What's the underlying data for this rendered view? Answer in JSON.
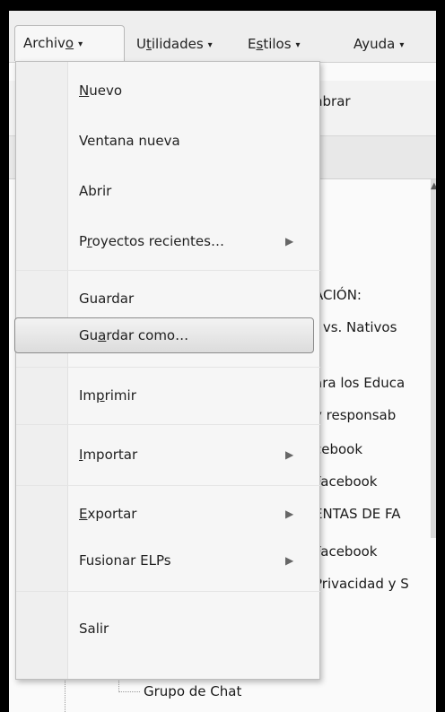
{
  "menubar": {
    "items": [
      {
        "label_pre": "Archiv",
        "label_u": "o",
        "label_post": "",
        "caret": "▾"
      },
      {
        "label_pre": "U",
        "label_u": "t",
        "label_post": "ilidades",
        "caret": "▾"
      },
      {
        "label_pre": "E",
        "label_u": "s",
        "label_post": "tilos",
        "caret": "▾"
      },
      {
        "label_pre": "Ayuda",
        "label_u": "",
        "label_post": "",
        "caret": "▾"
      }
    ]
  },
  "background": {
    "toolbar_fragment": "nbrar",
    "lines": [
      "ACIÓN:",
      "; vs. Nativos",
      "ara los Educa",
      "y responsab",
      "cebook",
      "Facebook",
      "ENTAS DE FA",
      "Facebook",
      "Privacidad y S",
      "Grupo de Chat"
    ]
  },
  "dropdown": {
    "items": [
      {
        "pre": "",
        "u": "N",
        "post": "uevo"
      },
      {
        "pre": "Ventana nueva",
        "u": "",
        "post": ""
      },
      {
        "pre": "Abrir",
        "u": "",
        "post": ""
      },
      {
        "pre": "P",
        "u": "r",
        "post": "oyectos recientes…",
        "arrow": "▶"
      },
      {
        "pre": "Guardar",
        "u": "",
        "post": ""
      },
      {
        "pre": "Gu",
        "u": "a",
        "post": "rdar como…"
      },
      {
        "pre": "Im",
        "u": "p",
        "post": "rimir"
      },
      {
        "pre": "",
        "u": "I",
        "post": "mportar",
        "arrow": "▶"
      },
      {
        "pre": "",
        "u": "E",
        "post": "xportar",
        "arrow": "▶"
      },
      {
        "pre": "Fusionar ELPs",
        "u": "",
        "post": "",
        "arrow": "▶"
      },
      {
        "pre": "Salir",
        "u": "",
        "post": ""
      }
    ]
  }
}
